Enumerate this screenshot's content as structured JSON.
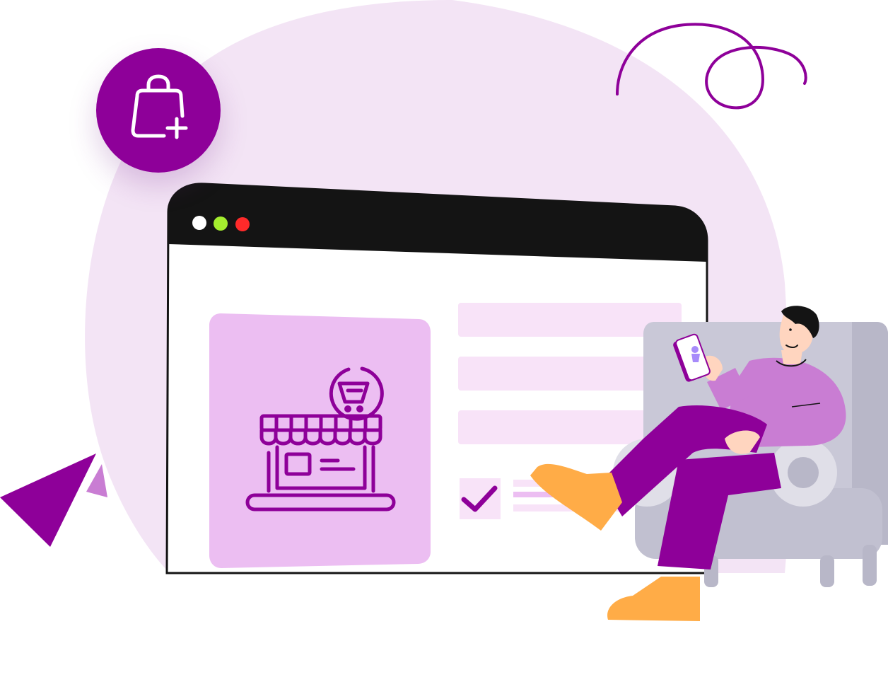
{
  "illustration": {
    "background_blob_color": "#f3e4f5",
    "accent_color": "#8e0099",
    "accent_light": "#ecbef2",
    "field_color": "#f8e3f8",
    "browser_bar_color": "#141414",
    "window_controls": [
      "#ffffff",
      "#a4ee2e",
      "#ff2a2a"
    ],
    "icons": {
      "badge": "shopping-bag-plus-icon",
      "storefront": "storefront-cart-icon",
      "check": "checkmark-icon",
      "arrow": "cursor-arrow-icon",
      "swirl": "decorative-swirl-icon"
    },
    "armchair_color": "#c9c8d7",
    "shoe_color": "#ffac47",
    "sweater_color": "#c97dd3",
    "pants_color": "#8e0099"
  }
}
